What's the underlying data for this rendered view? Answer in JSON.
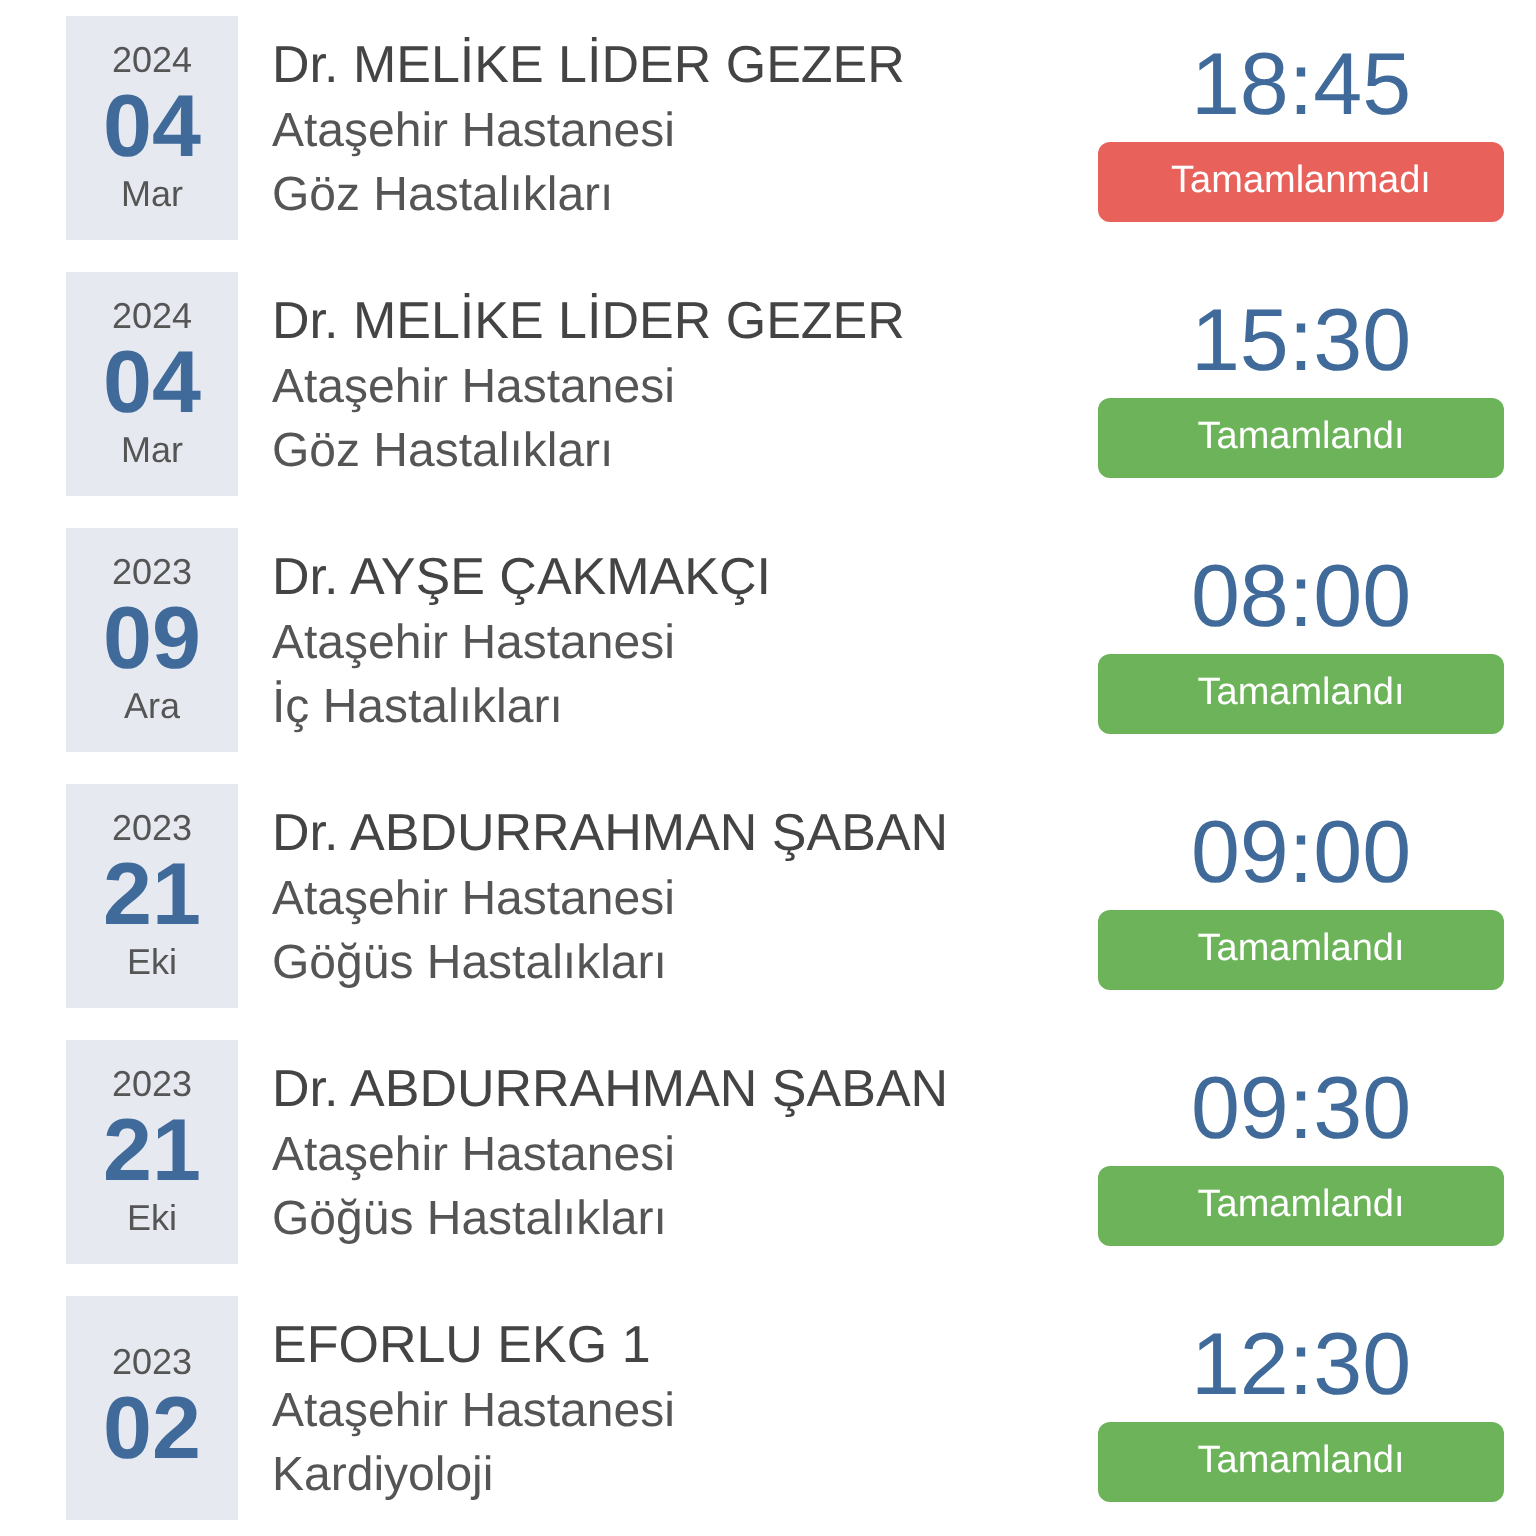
{
  "appointments": [
    {
      "year": "2024",
      "day": "04",
      "month": "Mar",
      "doctor": "Dr. MELİKE LİDER GEZER",
      "hospital": "Ataşehir Hastanesi",
      "department": "Göz Hastalıkları",
      "time": "18:45",
      "status": {
        "kind": "incomplete",
        "label": "Tamamlanmadı"
      }
    },
    {
      "year": "2024",
      "day": "04",
      "month": "Mar",
      "doctor": "Dr. MELİKE LİDER GEZER",
      "hospital": "Ataşehir Hastanesi",
      "department": "Göz Hastalıkları",
      "time": "15:30",
      "status": {
        "kind": "complete",
        "label": "Tamamlandı"
      }
    },
    {
      "year": "2023",
      "day": "09",
      "month": "Ara",
      "doctor": "Dr. AYŞE ÇAKMAKÇI",
      "hospital": "Ataşehir Hastanesi",
      "department": "İç Hastalıkları",
      "time": "08:00",
      "status": {
        "kind": "complete",
        "label": "Tamamlandı"
      }
    },
    {
      "year": "2023",
      "day": "21",
      "month": "Eki",
      "doctor": "Dr. ABDURRAHMAN ŞABAN",
      "hospital": "Ataşehir Hastanesi",
      "department": "Göğüs Hastalıkları",
      "time": "09:00",
      "status": {
        "kind": "complete",
        "label": "Tamamlandı"
      }
    },
    {
      "year": "2023",
      "day": "21",
      "month": "Eki",
      "doctor": "Dr. ABDURRAHMAN ŞABAN",
      "hospital": "Ataşehir Hastanesi",
      "department": "Göğüs Hastalıkları",
      "time": "09:30",
      "status": {
        "kind": "complete",
        "label": "Tamamlandı"
      }
    },
    {
      "year": "2023",
      "day": "02",
      "doctor": "EFORLU EKG 1",
      "hospital": "Ataşehir Hastanesi",
      "department": "Kardiyoloji",
      "time": "12:30",
      "status": {
        "kind": "complete",
        "label": "Tamamlandı"
      }
    }
  ]
}
